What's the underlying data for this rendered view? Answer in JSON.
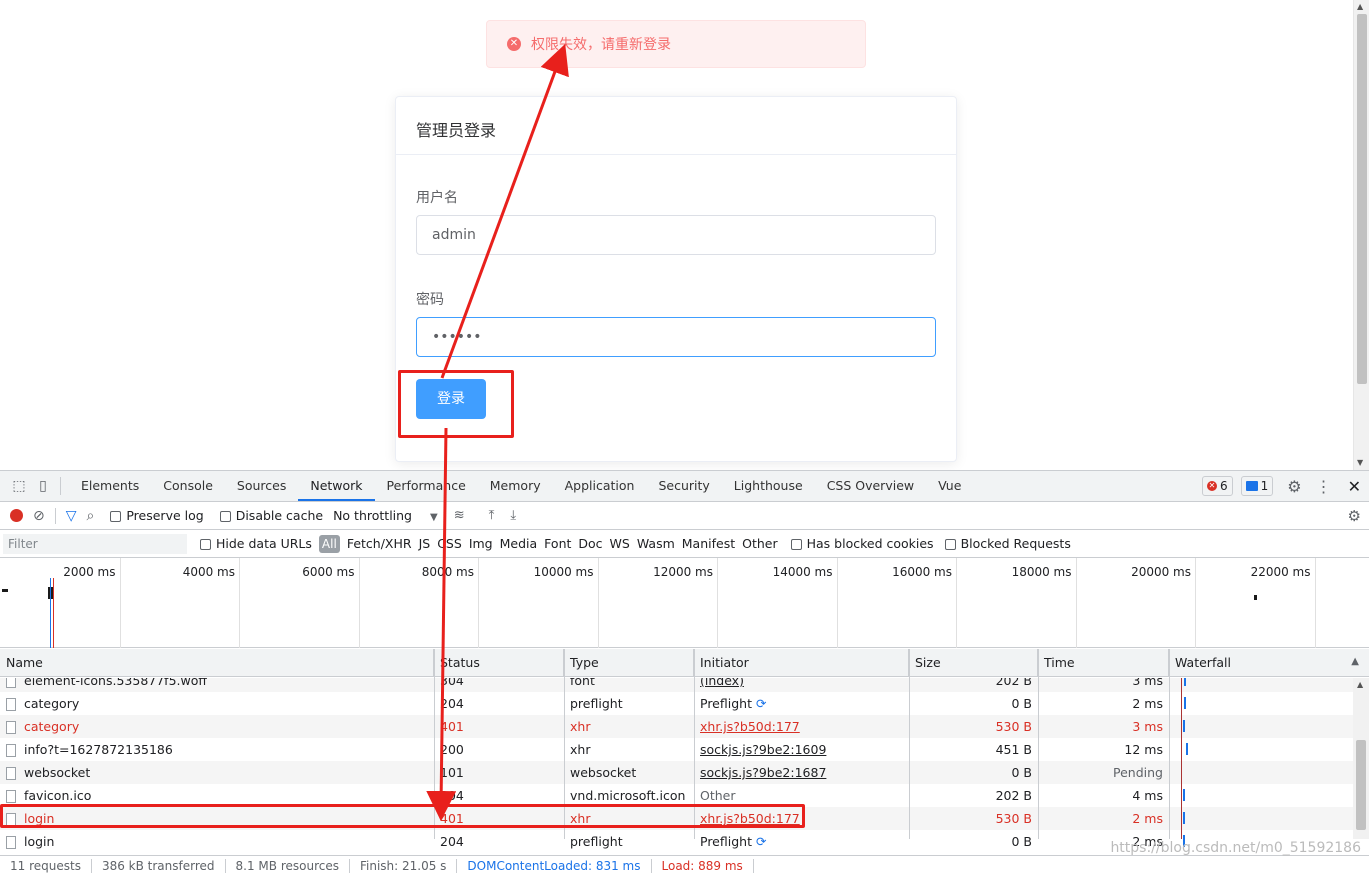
{
  "page": {
    "message": "权限失效，请重新登录",
    "card_title": "管理员登录",
    "username_label": "用户名",
    "username_value": "admin",
    "password_label": "密码",
    "password_value": "••••••",
    "login_button": "登录"
  },
  "devtools": {
    "tabs": [
      "Elements",
      "Console",
      "Sources",
      "Network",
      "Performance",
      "Memory",
      "Application",
      "Security",
      "Lighthouse",
      "CSS Overview",
      "Vue"
    ],
    "active_tab": "Network",
    "error_count": "6",
    "message_count": "1",
    "toolbar": {
      "preserve_log": "Preserve log",
      "disable_cache": "Disable cache",
      "throttling": "No throttling"
    },
    "filter": {
      "placeholder": "Filter",
      "hide_data_urls": "Hide data URLs",
      "all": "All",
      "types": [
        "Fetch/XHR",
        "JS",
        "CSS",
        "Img",
        "Media",
        "Font",
        "Doc",
        "WS",
        "Wasm",
        "Manifest",
        "Other"
      ],
      "has_blocked_cookies": "Has blocked cookies",
      "blocked_requests": "Blocked Requests"
    },
    "overview_labels": [
      "2000 ms",
      "4000 ms",
      "6000 ms",
      "8000 ms",
      "10000 ms",
      "12000 ms",
      "14000 ms",
      "16000 ms",
      "18000 ms",
      "20000 ms",
      "22000 ms"
    ],
    "columns": [
      "Name",
      "Status",
      "Type",
      "Initiator",
      "Size",
      "Time",
      "Waterfall"
    ],
    "rows": [
      {
        "name": "element-icons.535877f5.woff",
        "status": "304",
        "type": "font",
        "initiator": "(index)",
        "size": "202 B",
        "time": "3 ms",
        "error": false,
        "link": true
      },
      {
        "name": "category",
        "status": "204",
        "type": "preflight",
        "initiator": "Preflight",
        "size": "0 B",
        "time": "2 ms",
        "error": false,
        "link": false
      },
      {
        "name": "category",
        "status": "401",
        "type": "xhr",
        "initiator": "xhr.js?b50d:177",
        "size": "530 B",
        "time": "3 ms",
        "error": true,
        "link": true
      },
      {
        "name": "info?t=1627872135186",
        "status": "200",
        "type": "xhr",
        "initiator": "sockjs.js?9be2:1609",
        "size": "451 B",
        "time": "12 ms",
        "error": false,
        "link": true
      },
      {
        "name": "websocket",
        "status": "101",
        "type": "websocket",
        "initiator": "sockjs.js?9be2:1687",
        "size": "0 B",
        "time": "Pending",
        "error": false,
        "link": true
      },
      {
        "name": "favicon.ico",
        "status": "304",
        "type": "vnd.microsoft.icon",
        "initiator": "Other",
        "size": "202 B",
        "time": "4 ms",
        "error": false,
        "link": false
      },
      {
        "name": "login",
        "status": "401",
        "type": "xhr",
        "initiator": "xhr.js?b50d:177",
        "size": "530 B",
        "time": "2 ms",
        "error": true,
        "link": true
      },
      {
        "name": "login",
        "status": "204",
        "type": "preflight",
        "initiator": "Preflight",
        "size": "0 B",
        "time": "2 ms",
        "error": false,
        "link": false
      }
    ],
    "statusbar": [
      "11 requests",
      "386 kB transferred",
      "8.1 MB resources",
      "Finish: 21.05 s",
      "DOMContentLoaded: 831 ms",
      "Load: 889 ms"
    ]
  },
  "watermark": "https://blog.csdn.net/m0_51592186",
  "colors": {
    "primary": "#409eff",
    "error": "#f56c6c",
    "highlight": "#e8201c"
  }
}
